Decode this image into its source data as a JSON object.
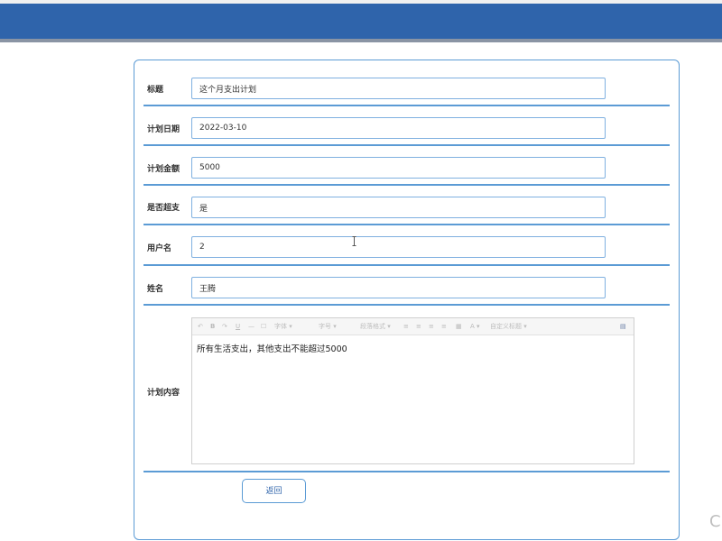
{
  "form": {
    "fields": [
      {
        "label": "标题",
        "value": "这个月支出计划"
      },
      {
        "label": "计划日期",
        "value": "2022-03-10"
      },
      {
        "label": "计划金额",
        "value": "5000"
      },
      {
        "label": "是否超支",
        "value": "是"
      },
      {
        "label": "用户名",
        "value": "2"
      },
      {
        "label": "姓名",
        "value": "王腾"
      }
    ],
    "content_label": "计划内容",
    "content_text": "所有生活支出，其他支出不能超过5000",
    "back_label": "返回"
  },
  "toolbar": {
    "font_family_placeholder": "字体",
    "font_size_placeholder": "字号",
    "paragraph_placeholder": "段落格式",
    "custom_heading_placeholder": "自定义标题"
  },
  "partial_corner_text": "C",
  "colors": {
    "header": "#2f64ab",
    "accent": "#5b9bd5"
  }
}
